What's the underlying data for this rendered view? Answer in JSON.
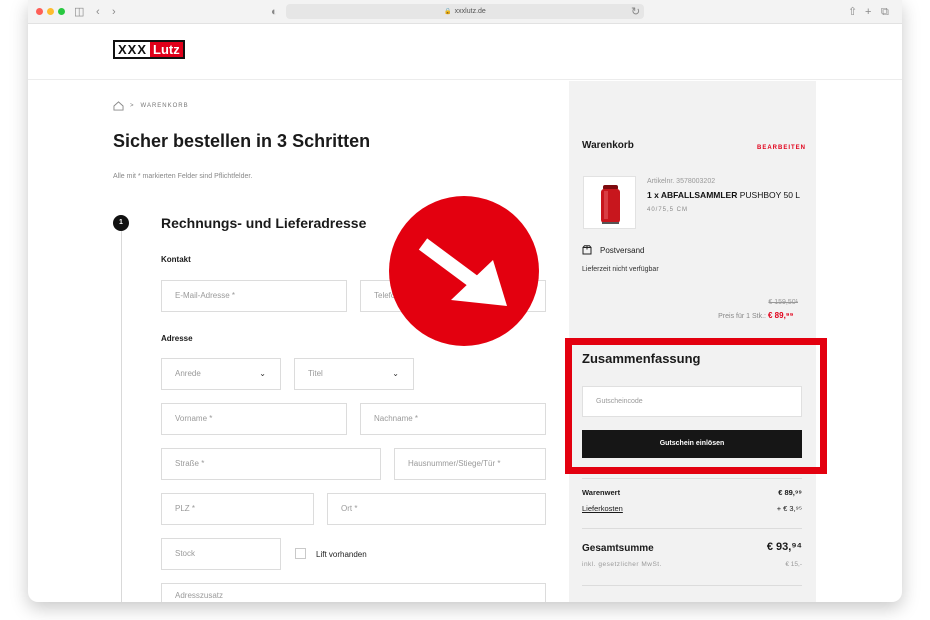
{
  "browser": {
    "url": "xxxlutz.de"
  },
  "header": {
    "logo_part1": "XXX",
    "logo_part2": "Lutz"
  },
  "breadcrumb": {
    "current": "WARENKORB"
  },
  "checkout": {
    "title": "Sicher bestellen in 3 Schritten",
    "required_hint": "Alle mit * markierten Felder sind Pflichtfelder.",
    "step_number": "1",
    "step_title": "Rechnungs- und Lieferadresse",
    "contact_label": "Kontakt",
    "address_label": "Adresse",
    "fields": {
      "email": "E-Mail-Adresse *",
      "phone": "Telefo",
      "salutation": "Anrede",
      "title": "Titel",
      "firstname": "Vorname *",
      "lastname": "Nachname *",
      "street": "Straße *",
      "house_number": "Hausnummer/Stiege/Tür *",
      "zip": "PLZ *",
      "city": "Ort *",
      "floor": "Stock",
      "address_extra": "Adresszusatz"
    },
    "lift_label": "Lift vorhanden"
  },
  "cart": {
    "title": "Warenkorb",
    "edit_label": "BEARBEITEN",
    "article_no": "Artikelnr. 3578003202",
    "product_qty_name": "1 x ABFALLSAMMLER",
    "product_name_rest": " PUSHBOY 50 L",
    "dimensions": "40/75,5 CM",
    "shipping_method": "Postversand",
    "delivery_info": "Lieferzeit nicht verfügbar",
    "old_price": "€ 159,50¹",
    "unit_price_label": "Preis für 1 Stk.:",
    "unit_price": "€ 89,⁹⁹"
  },
  "summary": {
    "title": "Zusammenfassung",
    "voucher_placeholder": "Gutscheincode",
    "voucher_button": "Gutschein einlösen",
    "goods_value_label": "Warenwert",
    "goods_value": "€ 89,⁹⁹",
    "shipping_cost_label": "Lieferkosten",
    "shipping_cost": "+ € 3,⁹⁵",
    "total_label": "Gesamtsumme",
    "total_value": "€ 93,⁹⁴",
    "vat_label": "inkl. gesetzlicher MwSt.",
    "vat_value": "€ 15,-"
  },
  "colors": {
    "brand_red": "#e1001a",
    "annotation_red": "#e3000f",
    "button_black": "#161616"
  }
}
